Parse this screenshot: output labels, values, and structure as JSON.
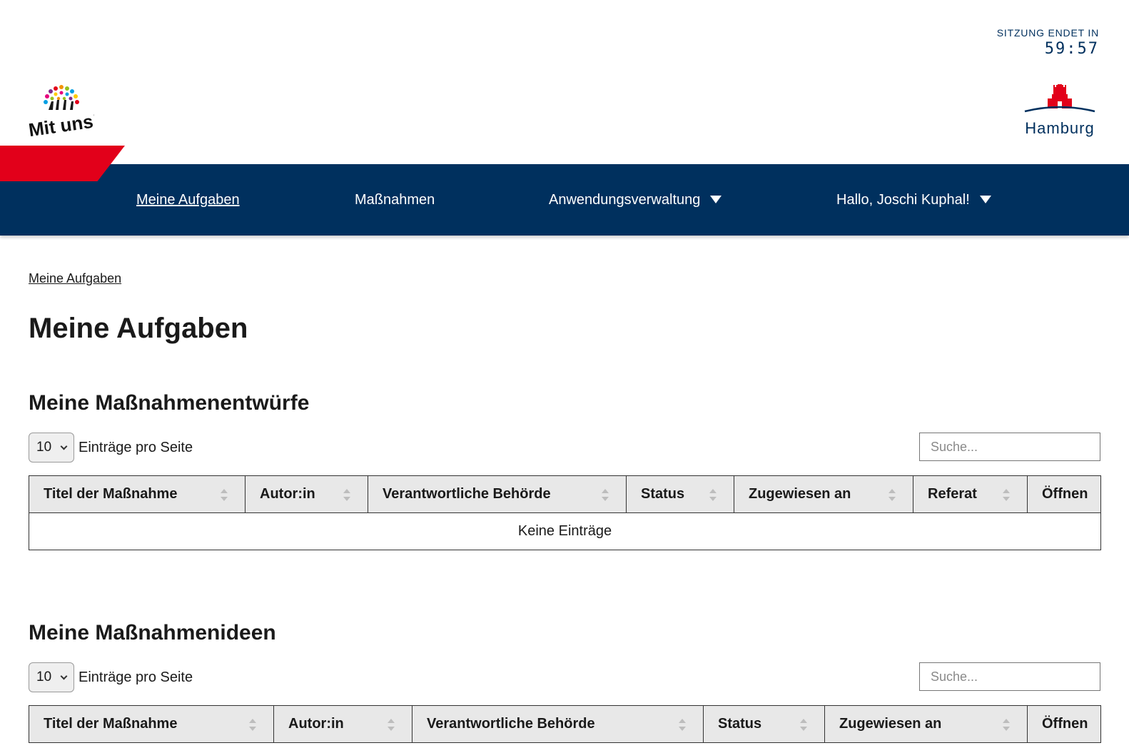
{
  "session": {
    "label": "SITZUNG ENDET IN",
    "timer": "59:57"
  },
  "logos": {
    "mituns_text": "Mit uns!",
    "hamburg_text": "Hamburg"
  },
  "nav": {
    "items": [
      {
        "label": "Meine Aufgaben",
        "active": true
      },
      {
        "label": "Maßnahmen"
      },
      {
        "label": "Anwendungsverwaltung"
      },
      {
        "label": "Hallo, Joschi Kuphal!"
      }
    ]
  },
  "breadcrumb": "Meine Aufgaben",
  "page_title": "Meine Aufgaben",
  "sections": [
    {
      "title": "Meine Maßnahmenentwürfe",
      "page_size": "10",
      "per_page_label": "Einträge pro Seite",
      "search_placeholder": "Suche...",
      "columns": [
        "Titel der Maßnahme",
        "Autor:in",
        "Verantwortliche Behörde",
        "Status",
        "Zugewiesen an",
        "Referat",
        "Öffnen"
      ],
      "empty_text": "Keine Einträge"
    },
    {
      "title": "Meine Maßnahmenideen",
      "page_size": "10",
      "per_page_label": "Einträge pro Seite",
      "search_placeholder": "Suche...",
      "columns": [
        "Titel der Maßnahme",
        "Autor:in",
        "Verantwortliche Behörde",
        "Status",
        "Zugewiesen an",
        "Öffnen"
      ]
    }
  ],
  "colors": {
    "primary": "#00305e",
    "accent": "#e2001a",
    "header_cell": "#e8e8e8"
  }
}
